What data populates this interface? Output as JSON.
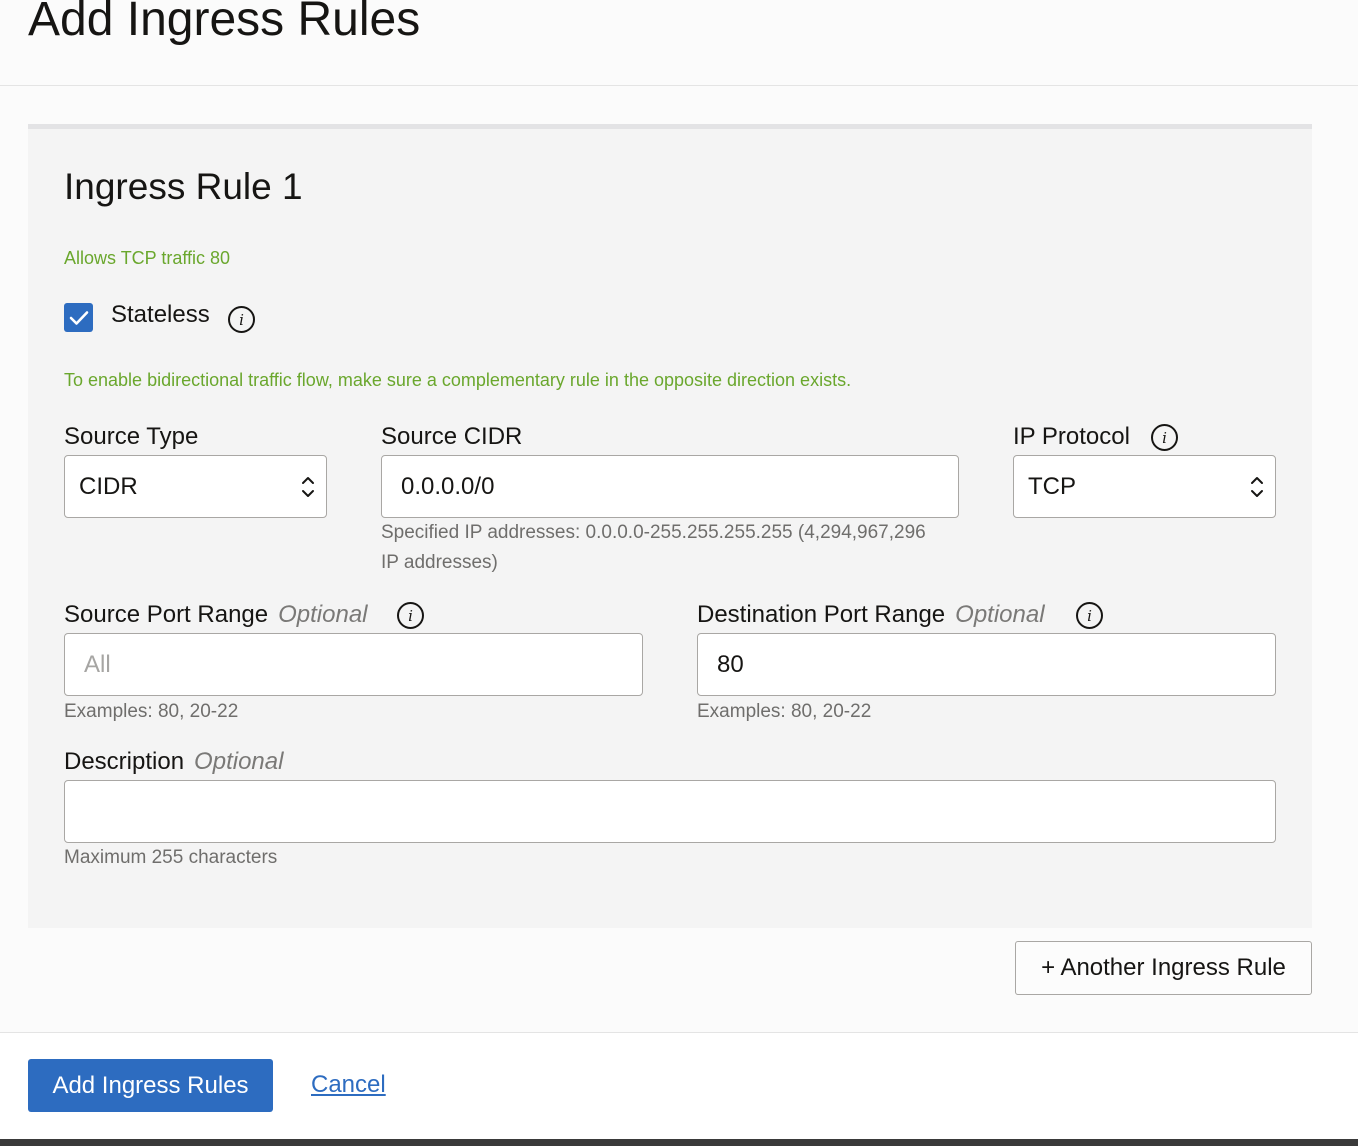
{
  "header": {
    "title": "Add Ingress Rules"
  },
  "rule": {
    "title": "Ingress Rule 1",
    "summary": "Allows TCP traffic 80",
    "stateless": {
      "label": "Stateless",
      "checked": true
    },
    "stateless_hint": "To enable bidirectional traffic flow, make sure a complementary rule in the opposite direction exists.",
    "source_type": {
      "label": "Source Type",
      "value": "CIDR"
    },
    "source_cidr": {
      "label": "Source CIDR",
      "value": "0.0.0.0/0",
      "help_line1": "Specified IP addresses: 0.0.0.0-255.255.255.255 (4,294,967,296",
      "help_line2": "IP addresses)"
    },
    "ip_protocol": {
      "label": "IP Protocol",
      "value": "TCP"
    },
    "source_port_range": {
      "label": "Source Port Range",
      "optional": "Optional",
      "placeholder": "All",
      "help": "Examples: 80, 20-22"
    },
    "destination_port_range": {
      "label": "Destination Port Range",
      "optional": "Optional",
      "value": "80",
      "help": "Examples: 80, 20-22"
    },
    "description": {
      "label": "Description",
      "optional": "Optional",
      "value": "",
      "help": "Maximum 255 characters"
    }
  },
  "another_rule_button": "+ Another Ingress Rule",
  "footer": {
    "submit_label": "Add Ingress Rules",
    "cancel_label": "Cancel"
  },
  "colors": {
    "accent": "#2d6cc0",
    "success_text": "#6aa72d",
    "card_bg": "#f4f4f4"
  }
}
